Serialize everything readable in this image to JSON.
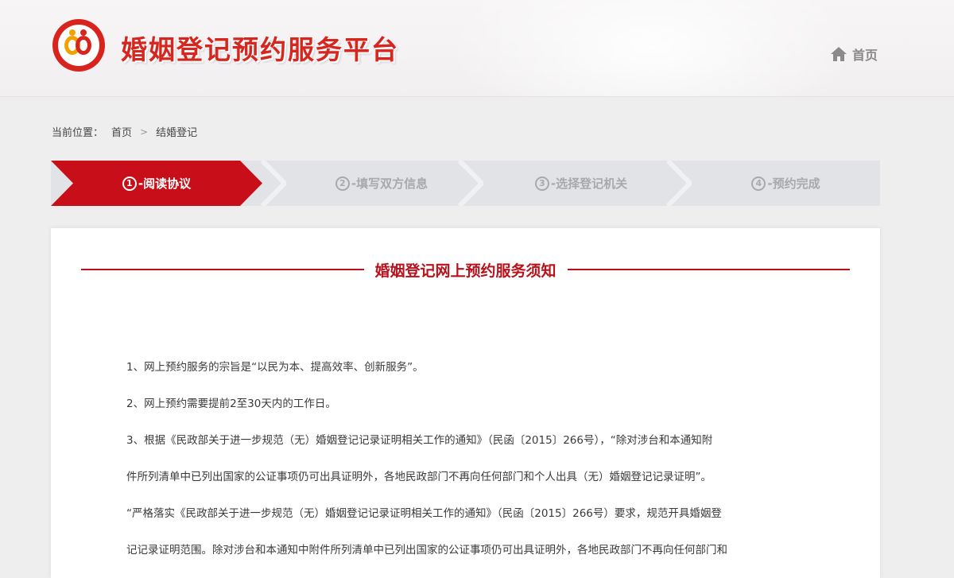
{
  "header": {
    "title": "婚姻登记预约服务平台",
    "home_label": "首页",
    "logo_icon": "marriage-registration-logo",
    "brand_color": "#d5271f"
  },
  "breadcrumb": {
    "prefix": "当前位置：",
    "items": [
      "首页",
      "结婚登记"
    ],
    "separator": ">"
  },
  "steps": [
    {
      "num": "①",
      "label": "-阅读协议",
      "active": true
    },
    {
      "num": "②",
      "label": "-填写双方信息",
      "active": false
    },
    {
      "num": "③",
      "label": "-选择登记机关",
      "active": false
    },
    {
      "num": "④",
      "label": "-预约完成",
      "active": false
    }
  ],
  "notice": {
    "title": "婚姻登记网上预约服务须知",
    "paragraphs": [
      "1、网上预约服务的宗旨是“以民为本、提高效率、创新服务”。",
      "2、网上预约需要提前2至30天内的工作日。",
      "3、根据《民政部关于进一步规范（无）婚姻登记记录证明相关工作的通知》（民函〔2015〕266号），“除对涉台和本通知附",
      "件所列清单中已列出国家的公证事项仍可出具证明外，各地民政部门不再向任何部门和个人出具（无）婚姻登记记录证明”。",
      "“严格落实《民政部关于进一步规范（无）婚姻登记记录证明相关工作的通知》（民函〔2015〕266号）要求，规范开具婚姻登",
      "记记录证明范围。除对涉台和本通知中附件所列清单中已列出国家的公证事项仍可出具证明外，各地民政部门不再向任何部门和"
    ]
  },
  "colors": {
    "active_step": "#c80f19",
    "inactive_step_bg": "#e2e3e6",
    "inactive_step_text": "#a7a9ad",
    "notice_title": "#b7121c"
  }
}
